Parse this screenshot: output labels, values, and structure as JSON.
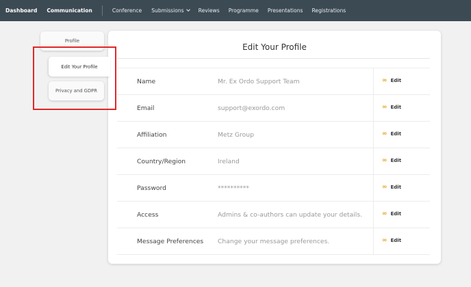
{
  "topnav": {
    "dashboard": "Dashboard",
    "communication": "Communication",
    "conference": "Conference",
    "submissions": "Submissions",
    "reviews": "Reviews",
    "programme": "Programme",
    "presentations": "Presentations",
    "registrations": "Registrations"
  },
  "sidebar": {
    "profile": "Profile",
    "edit_profile": "Edit Your Profile",
    "privacy": "Privacy and GDPR"
  },
  "card": {
    "title": "Edit Your Profile",
    "edit_label": "Edit",
    "edit_icon": "link-icon",
    "rows": [
      {
        "label": "Name",
        "value": "Mr. Ex Ordo Support Team"
      },
      {
        "label": "Email",
        "value": "support@exordo.com"
      },
      {
        "label": "Affiliation",
        "value": "Metz Group"
      },
      {
        "label": "Country/Region",
        "value": "Ireland"
      },
      {
        "label": "Password",
        "value": "**********"
      },
      {
        "label": "Access",
        "value": "Admins & co-authors can update your details."
      },
      {
        "label": "Message Preferences",
        "value": "Change your message preferences."
      }
    ]
  },
  "colors": {
    "topbar": "#3c4a53",
    "accent_edit_icon": "#e8a21d",
    "highlight_box": "#e02626"
  }
}
